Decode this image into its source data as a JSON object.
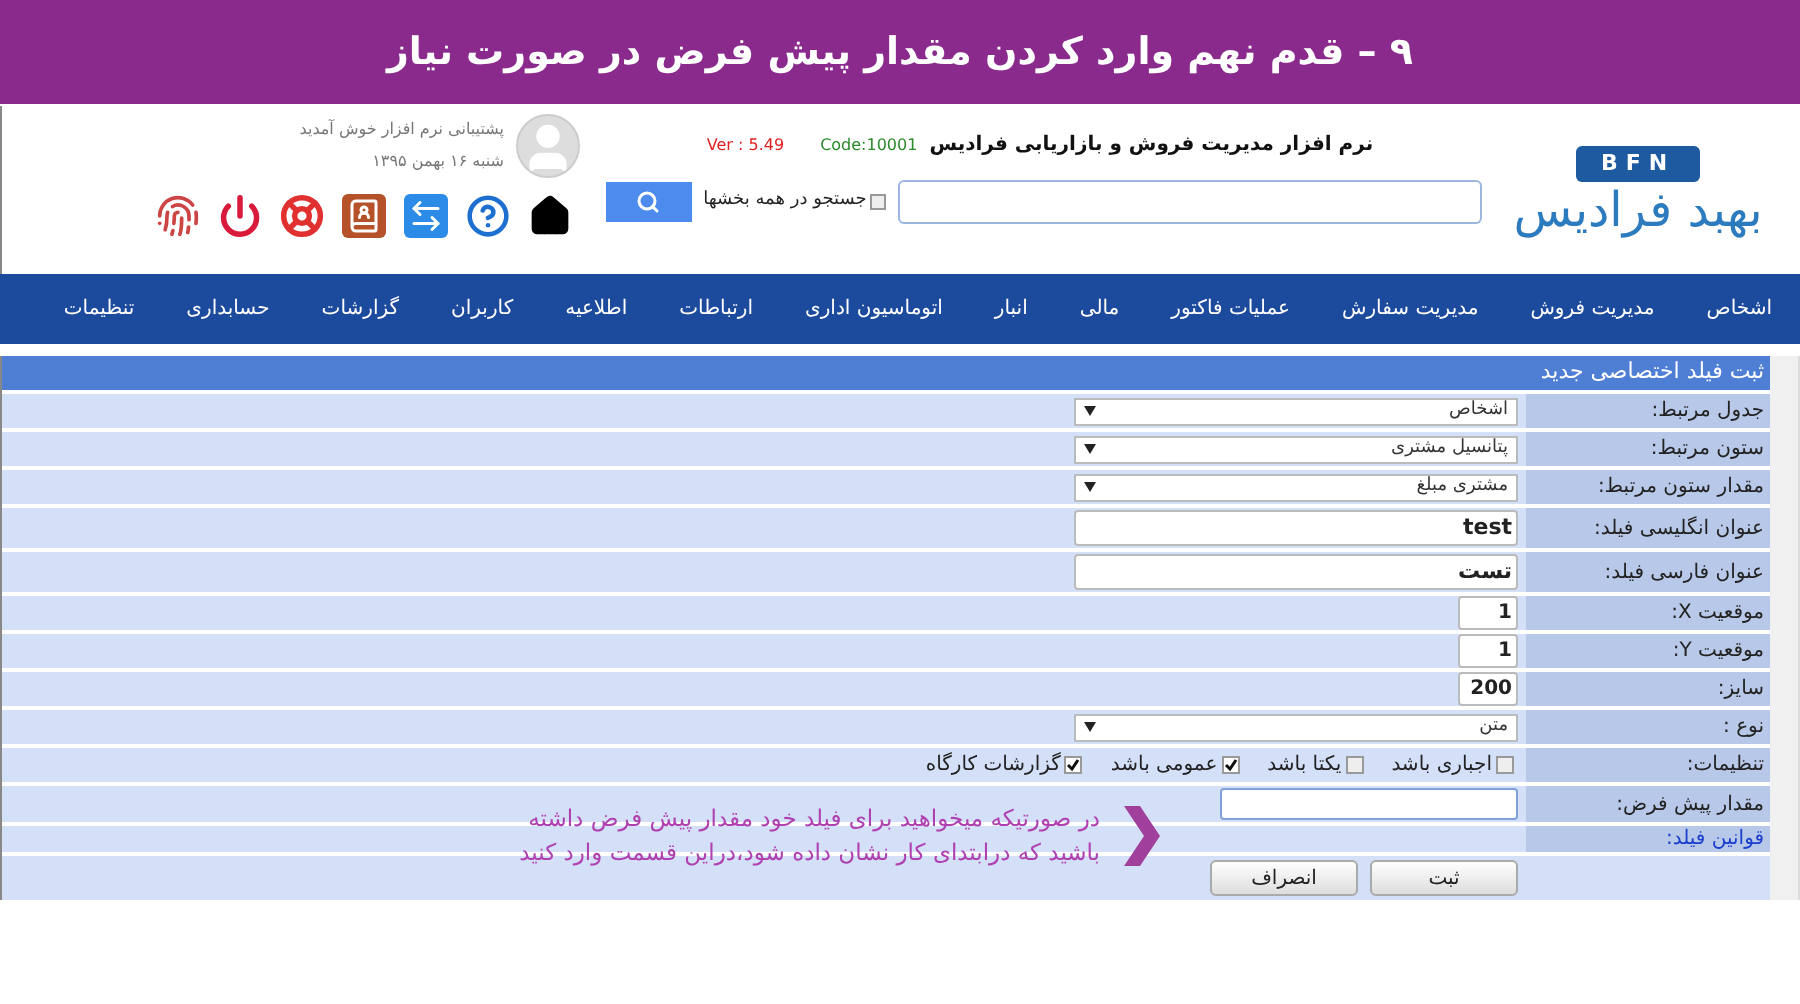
{
  "banner": {
    "title": "۹ – قدم نهم وارد کردن مقدار پیش فرض در صورت نیاز"
  },
  "header": {
    "welcome": "پشتیبانی نرم افزار خوش آمدید",
    "date": "شنبه ۱۶ بهمن ۱۳۹۵",
    "app_title": "نرم افزار مدیریت فروش و بازاریابی فرادیس",
    "code": "Code:10001",
    "version": "Ver : 5.49",
    "search_all": {
      "label": "جستجو در همه بخشها",
      "checked": false
    },
    "logo": {
      "badge": "BFN",
      "name": "بهبد فرادیس"
    }
  },
  "nav": [
    "اشخاص",
    "مدیریت فروش",
    "مدیریت سفارش",
    "عملیات فاکتور",
    "مالی",
    "انبار",
    "اتوماسیون اداری",
    "ارتباطات",
    "اطلاعیه",
    "کاربران",
    "گزارشات",
    "حسابداری",
    "تنظیمات"
  ],
  "form": {
    "title": "ثبت فیلد اختصاصی جدید",
    "rows": [
      {
        "kind": "select",
        "label": "جدول مرتبط:",
        "value": "اشخاص"
      },
      {
        "kind": "select",
        "label": "ستون مرتبط:",
        "value": "پتانسیل مشتری"
      },
      {
        "kind": "select",
        "label": "مقدار ستون مرتبط:",
        "value": "مشتری مبلغ"
      },
      {
        "kind": "text",
        "label": "عنوان انگلیسی فیلد:",
        "value": "test"
      },
      {
        "kind": "text",
        "label": "عنوان فارسی فیلد:",
        "value": "تست"
      },
      {
        "kind": "number",
        "label": "موقعیت X:",
        "value": "1"
      },
      {
        "kind": "number",
        "label": "موقعیت Y:",
        "value": "1"
      },
      {
        "kind": "number",
        "label": "سایز:",
        "value": "200"
      },
      {
        "kind": "select",
        "label": "نوع :",
        "value": "متن"
      },
      {
        "kind": "checks",
        "label": "تنظیمات:",
        "options": [
          {
            "label": "اجباری باشد",
            "checked": false
          },
          {
            "label": "یکتا باشد",
            "checked": false
          },
          {
            "label": "عمومی باشد",
            "checked": true
          },
          {
            "label": "گزارشات کارگاه",
            "checked": true
          }
        ]
      },
      {
        "kind": "default",
        "label": "مقدار پیش فرض:",
        "value": ""
      },
      {
        "kind": "link",
        "label": "قوانین فیلد:"
      }
    ],
    "buttons": [
      "ثبت",
      "انصراف"
    ]
  },
  "callout": {
    "lines": [
      "در صورتیکه میخواهید برای فیلد خود مقدار پیش فرض داشته",
      "باشید که درابتدای کار نشان داده شود،دراین قسمت وارد کنید"
    ]
  }
}
